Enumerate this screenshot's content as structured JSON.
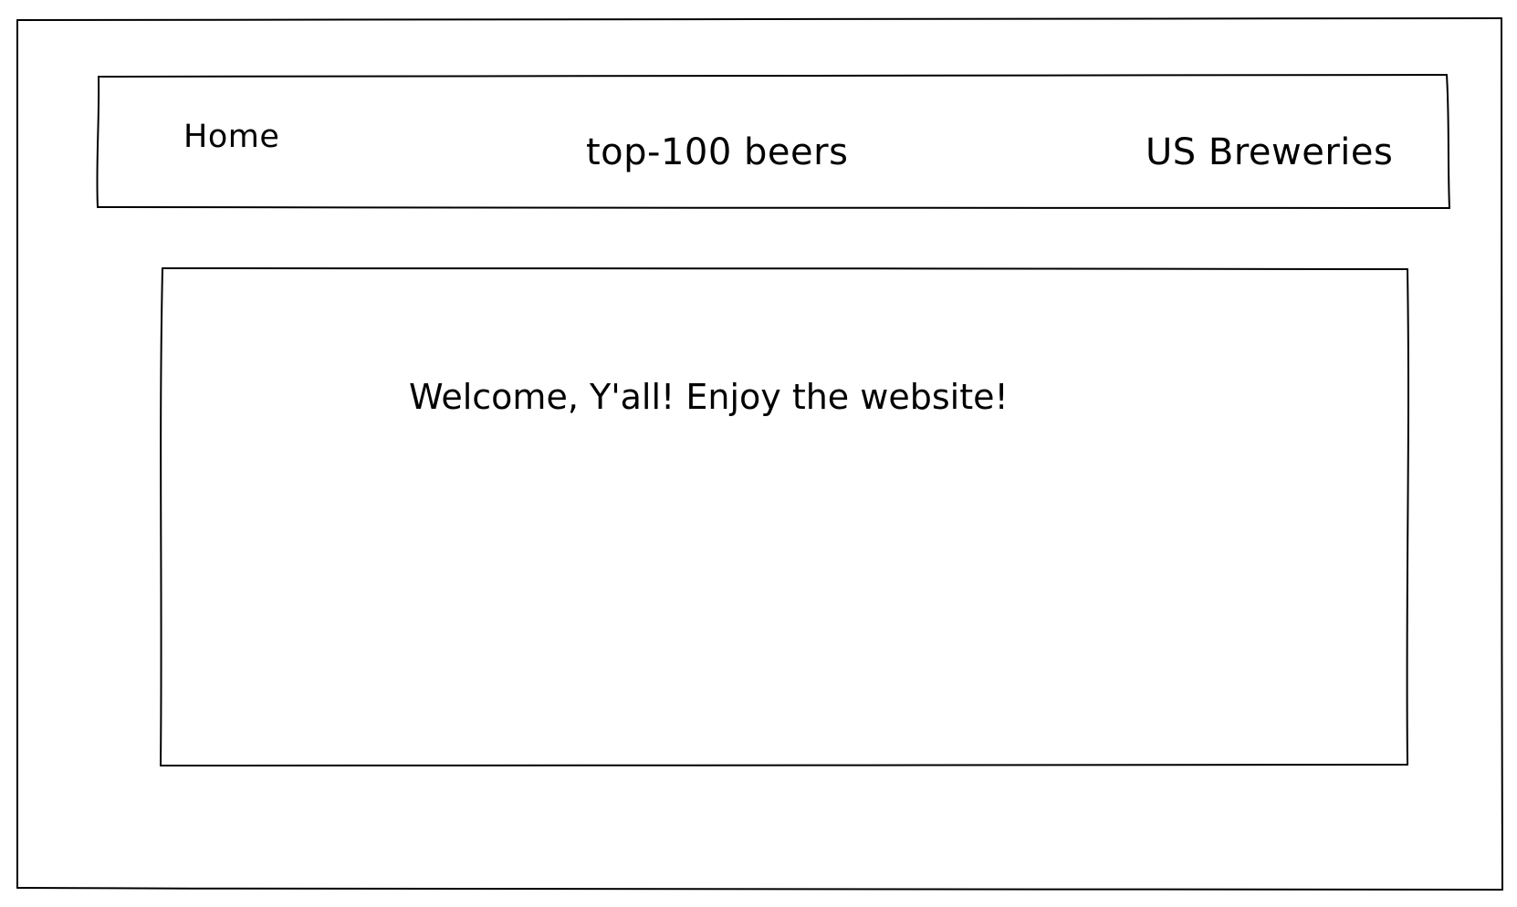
{
  "nav": {
    "home_label": "Home",
    "beers_label": "top-100 beers",
    "breweries_label": "US Breweries"
  },
  "main": {
    "welcome_text": "Welcome, Y'all! Enjoy the website!"
  },
  "colors": {
    "stroke": "#000000",
    "background": "#ffffff"
  }
}
